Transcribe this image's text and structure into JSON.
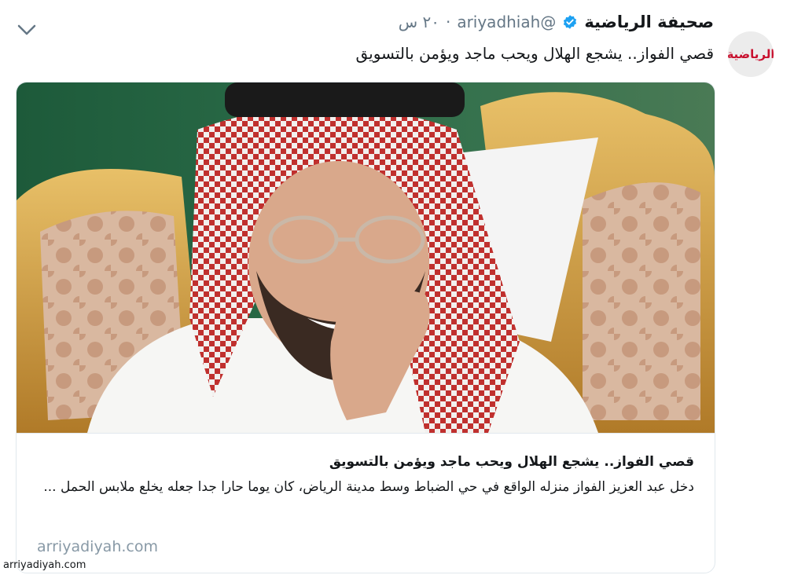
{
  "tweet": {
    "display_name": "صحيفة الرياضية",
    "handle": "@ariyadhiah",
    "separator": "·",
    "timestamp": "٢٠ س",
    "text": "قصي الفواز.. يشجع الهلال ويحب ماجد ويؤمن بالتسويق",
    "avatar_text": "الرياضية",
    "verified_color": "#1da1f2",
    "icons": {
      "menu": "chevron-down-icon",
      "verified": "verified-badge-icon"
    }
  },
  "card": {
    "title": "قصي الفواز.. يشجع الهلال ويحب ماجد ويؤمن بالتسويق",
    "description": "دخل عبد العزيز الفواز منزله الواقع في حي الضباط وسط مدينة الرياض، كان يوما حارا جدا جعله يخلع ملابس الحمل ...",
    "domain": "arriyadiyah.com"
  },
  "watermark": "arriyadiyah.com"
}
